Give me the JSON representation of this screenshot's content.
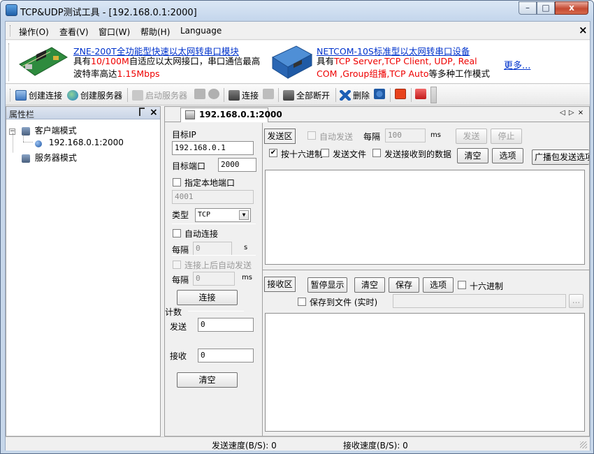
{
  "window": {
    "title": "TCP&UDP测试工具 - [192.168.0.1:2000]",
    "controls": {
      "minimize": "–",
      "maximize": "□",
      "close": "x"
    }
  },
  "menubar": {
    "items": [
      "操作(O)",
      "查看(V)",
      "窗口(W)",
      "帮助(H)",
      "Language"
    ],
    "close_glyph": "×"
  },
  "banner": {
    "ad1": {
      "title": "ZNE-200T全功能型快速以太网转串口模块",
      "line1_a": "具有",
      "line1_b": "10/100M",
      "line1_c": "自适应以太网接口，串口通信最高",
      "line2_a": "波特率高达",
      "line2_b": "1.15Mbps"
    },
    "ad2": {
      "title": "NETCOM-10S标准型以太网转串口设备",
      "line1_a": "具有",
      "line1_b": "TCP Server,TCP Client, UDP, Real",
      "line2_a": "COM ,Group组播,TCP Auto",
      "line2_b": "等多种工作模式"
    },
    "more": "更多..."
  },
  "toolbar": {
    "create_connection": "创建连接",
    "create_server": "创建服务器",
    "start_server": "启动服务器",
    "connect": "连接",
    "disconnect_all": "全部断开",
    "delete": "删除"
  },
  "left_panel": {
    "title": "属性栏",
    "pin_glyph": "ᅟ",
    "close_glyph": "×",
    "tree": {
      "client_mode": "客户端模式",
      "client_entry": "192.168.0.1:2000",
      "server_mode": "服务器模式",
      "expand_glyph": "−"
    }
  },
  "tab": {
    "label": "192.168.0.1:2000",
    "nav": "◁ ▷ ×"
  },
  "connection": {
    "target_ip_label": "目标IP",
    "target_ip": "192.168.0.1",
    "target_port_label": "目标端口",
    "target_port": "2000",
    "local_port_label": "指定本地端口",
    "local_port": "4001",
    "type_label": "类型",
    "type_value": "TCP",
    "auto_connect_label": "自动连接",
    "interval_label": "每隔",
    "interval_value": "0",
    "interval_unit_s": "s",
    "auto_send_label": "连接上后自动发送",
    "interval2_label": "每隔",
    "interval2_value": "0",
    "interval2_unit": "ms",
    "connect_button": "连接",
    "count_label": "计数",
    "send_label": "发送",
    "send_count": "0",
    "recv_label": "接收",
    "recv_count": "0",
    "clear_button": "清空"
  },
  "send_area": {
    "label": "发送区",
    "auto_send": "自动发送",
    "interval_label": "每隔",
    "interval_value": "100",
    "interval_unit": "ms",
    "send_button": "发送",
    "stop_button": "停止",
    "hex_label": "按十六进制",
    "send_file_label": "发送文件",
    "send_received_label": "发送接收到的数据",
    "clear_button": "清空",
    "options_button": "选项",
    "broadcast_button": "广播包发送选项",
    "check_mark": "✔"
  },
  "recv_area": {
    "label": "接收区",
    "pause_button": "暂停显示",
    "clear_button": "清空",
    "save_button": "保存",
    "options_button": "选项",
    "hex_label": "十六进制",
    "save_file_label": "保存到文件 (实时)",
    "browse_button": "..."
  },
  "status": {
    "send_speed": "发送速度(B/S): 0",
    "recv_speed": "接收速度(B/S): 0"
  }
}
